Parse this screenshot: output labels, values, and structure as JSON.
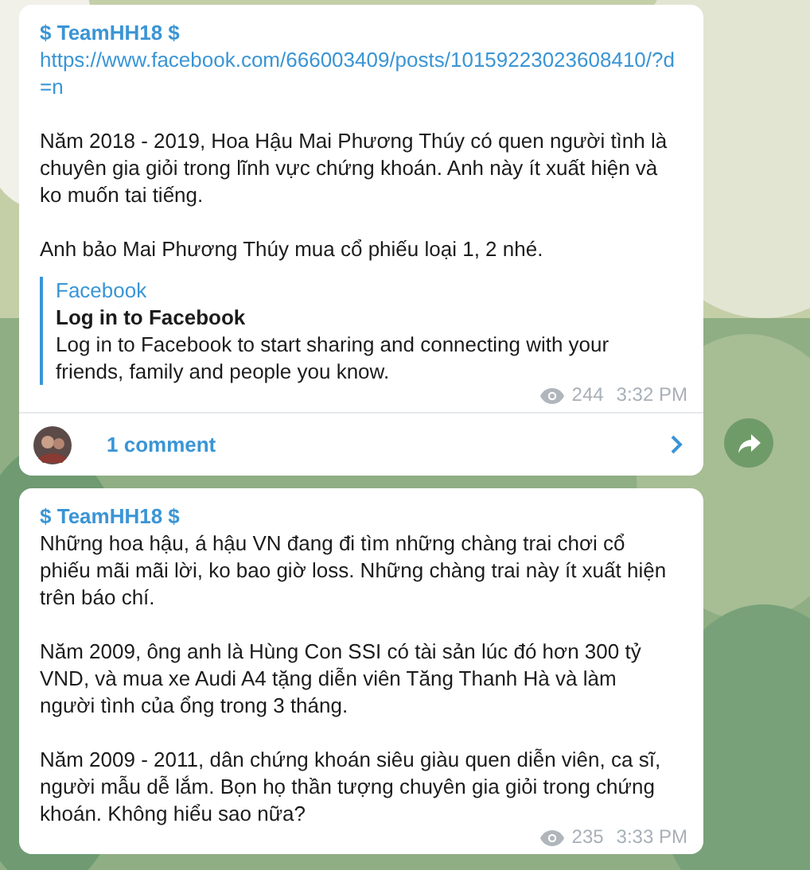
{
  "posts": [
    {
      "author": "$ TeamHH18 $",
      "link": "https://www.facebook.com/666003409/posts/10159223023608410/?d=n",
      "paragraphs": [
        "Năm 2018 - 2019, Hoa Hậu Mai Phương Thúy có quen người tình là chuyên gia giỏi trong lĩnh vực chứng khoán. Anh này ít xuất hiện và ko muốn tai tiếng.",
        "Anh bảo Mai Phương Thúy mua cổ phiếu loại 1, 2 nhé."
      ],
      "preview": {
        "site": "Facebook",
        "title": "Log in to Facebook",
        "description": "Log in to Facebook to start sharing and connecting with your friends, family and people you know."
      },
      "views": "244",
      "time": "3:32 PM",
      "comments": "1 comment"
    },
    {
      "author": "$ TeamHH18 $",
      "paragraphs": [
        "Những hoa hậu, á hậu VN đang đi tìm những chàng trai chơi cổ phiếu mãi mãi lời, ko bao giờ loss. Những chàng trai này ít xuất hiện trên báo chí.",
        "Năm 2009, ông anh là Hùng Con SSI có tài sản lúc đó hơn 300 tỷ VND, và mua xe Audi A4 tặng diễn viên Tăng Thanh Hà và làm người tình của ổng trong 3 tháng.",
        "Năm 2009 - 2011, dân chứng khoán siêu giàu quen diễn viên, ca sĩ, người mẫu dễ lắm. Bọn họ thần tượng chuyên gia giỏi trong chứng khoán. Không hiểu sao nữa?"
      ],
      "views": "235",
      "time": "3:33 PM"
    }
  ]
}
